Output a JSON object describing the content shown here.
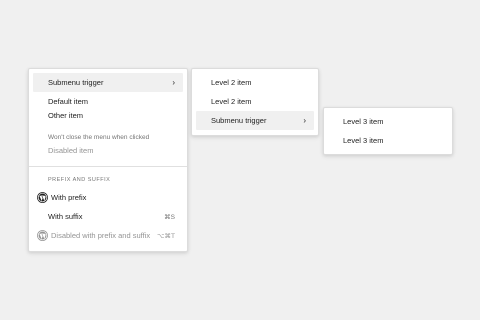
{
  "main_menu": {
    "submenu_trigger": "Submenu trigger",
    "submenu_chevron": "›",
    "default_item": "Default item",
    "other_item": "Other item",
    "other_item_help": "Won't close the menu when clicked",
    "disabled_item": "Disabled item",
    "group_label": "PREFIX AND SUFFIX",
    "with_prefix": "With prefix",
    "with_suffix": "With suffix",
    "with_suffix_shortcut": "⌘S",
    "disabled_prefix_suffix": "Disabled with prefix and suffix",
    "disabled_prefix_suffix_shortcut": "⌥⌘T",
    "prefix_icon": "wordpress-icon"
  },
  "level2_menu": {
    "item_1": "Level 2 item",
    "item_2": "Level 2 item",
    "submenu_trigger": "Submenu trigger",
    "submenu_chevron": "›"
  },
  "level3_menu": {
    "item_1": "Level 3 item",
    "item_2": "Level 3 item"
  },
  "colors": {
    "background": "#f0f0f0",
    "menu_bg": "#ffffff",
    "active_item_bg": "#f0f0f0",
    "text": "#1e1e1e",
    "muted_text": "#757575",
    "disabled_text": "#949494"
  }
}
